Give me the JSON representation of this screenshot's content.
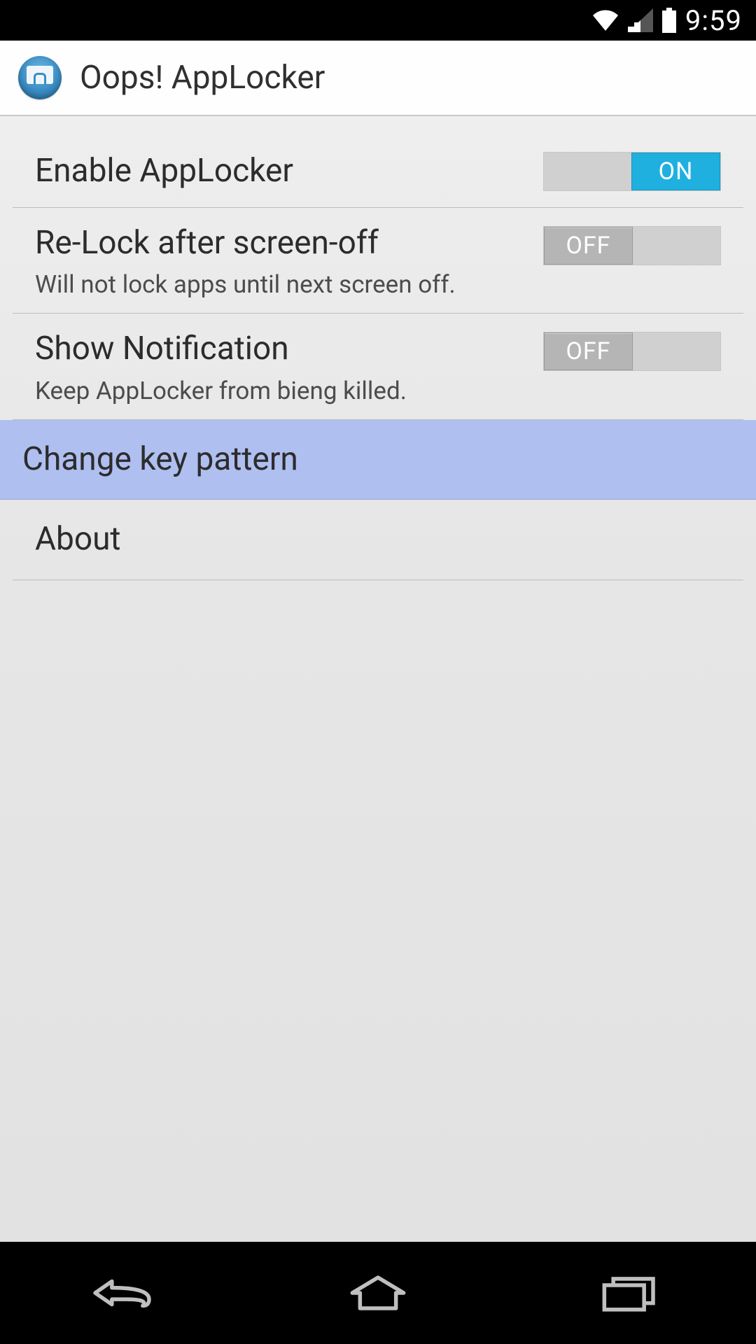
{
  "status": {
    "time": "9:59"
  },
  "header": {
    "title": "Oops! AppLocker"
  },
  "settings": {
    "enable": {
      "title": "Enable AppLocker",
      "state": "ON"
    },
    "relock": {
      "title": "Re-Lock after screen-off",
      "subtitle": "Will not lock apps until next screen off.",
      "state": "OFF"
    },
    "notif": {
      "title": "Show Notification",
      "subtitle": "Keep AppLocker from bieng killed.",
      "state": "OFF"
    },
    "pattern": {
      "title": "Change key pattern"
    },
    "about": {
      "title": "About"
    }
  }
}
